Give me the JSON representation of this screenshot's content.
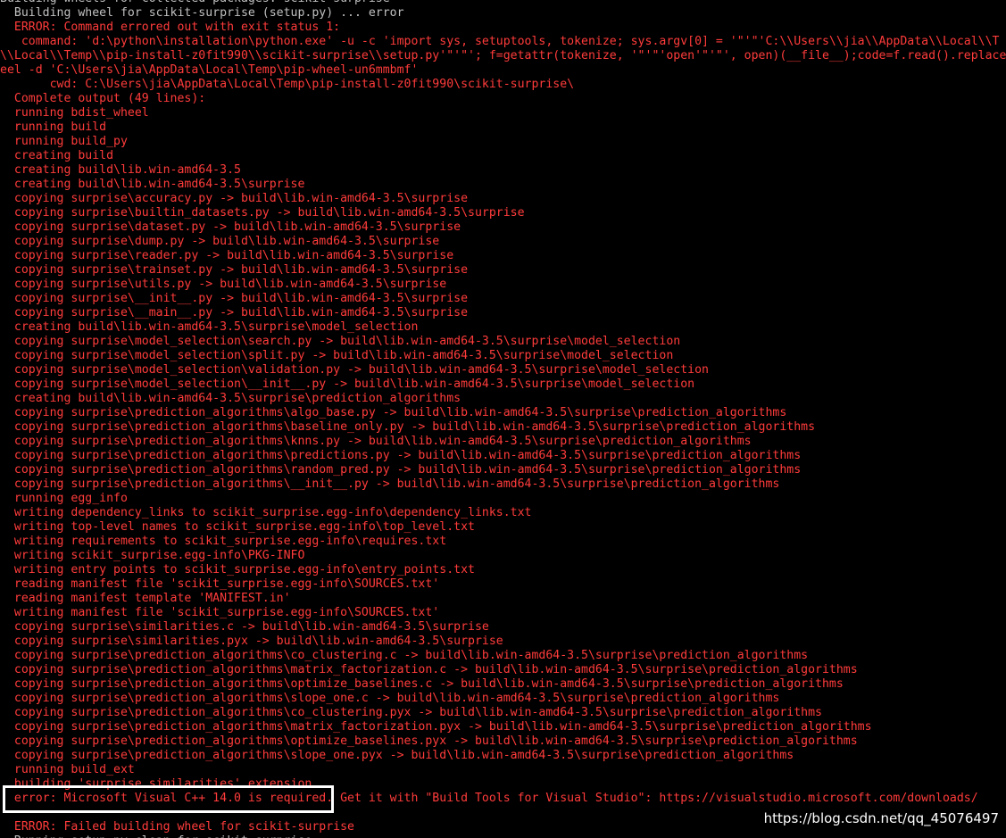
{
  "terminal": {
    "lines": [
      {
        "text": "Building wheels for collected packages: scikit-surprise",
        "color": "gray"
      },
      {
        "text": "  Building wheel for scikit-surprise (setup.py) ... error",
        "color": "gray"
      },
      {
        "text": "  ERROR: Command errored out with exit status 1:",
        "color": "red"
      },
      {
        "text": "   command: 'd:\\python\\installation\\python.exe' -u -c 'import sys, setuptools, tokenize; sys.argv[0] = '\"'\"'C:\\\\Users\\\\jia\\\\AppData\\\\Local\\\\T",
        "color": "red"
      },
      {
        "text": "\\\\Local\\\\Temp\\\\pip-install-z0fit990\\\\scikit-surprise\\\\setup.py'\"'\"'; f=getattr(tokenize, '\"'\"'open'\"'\"', open)(__file__);code=f.read().replace",
        "color": "red"
      },
      {
        "text": "eel -d 'C:\\Users\\jia\\AppData\\Local\\Temp\\pip-wheel-un6mmbmf'",
        "color": "red"
      },
      {
        "text": "       cwd: C:\\Users\\jia\\AppData\\Local\\Temp\\pip-install-z0fit990\\scikit-surprise\\",
        "color": "red"
      },
      {
        "text": "  Complete output (49 lines):",
        "color": "red"
      },
      {
        "text": "  running bdist_wheel",
        "color": "red"
      },
      {
        "text": "  running build",
        "color": "red"
      },
      {
        "text": "  running build_py",
        "color": "red"
      },
      {
        "text": "  creating build",
        "color": "red"
      },
      {
        "text": "  creating build\\lib.win-amd64-3.5",
        "color": "red"
      },
      {
        "text": "  creating build\\lib.win-amd64-3.5\\surprise",
        "color": "red"
      },
      {
        "text": "  copying surprise\\accuracy.py -> build\\lib.win-amd64-3.5\\surprise",
        "color": "red"
      },
      {
        "text": "  copying surprise\\builtin_datasets.py -> build\\lib.win-amd64-3.5\\surprise",
        "color": "red"
      },
      {
        "text": "  copying surprise\\dataset.py -> build\\lib.win-amd64-3.5\\surprise",
        "color": "red"
      },
      {
        "text": "  copying surprise\\dump.py -> build\\lib.win-amd64-3.5\\surprise",
        "color": "red"
      },
      {
        "text": "  copying surprise\\reader.py -> build\\lib.win-amd64-3.5\\surprise",
        "color": "red"
      },
      {
        "text": "  copying surprise\\trainset.py -> build\\lib.win-amd64-3.5\\surprise",
        "color": "red"
      },
      {
        "text": "  copying surprise\\utils.py -> build\\lib.win-amd64-3.5\\surprise",
        "color": "red"
      },
      {
        "text": "  copying surprise\\__init__.py -> build\\lib.win-amd64-3.5\\surprise",
        "color": "red"
      },
      {
        "text": "  copying surprise\\__main__.py -> build\\lib.win-amd64-3.5\\surprise",
        "color": "red"
      },
      {
        "text": "  creating build\\lib.win-amd64-3.5\\surprise\\model_selection",
        "color": "red"
      },
      {
        "text": "  copying surprise\\model_selection\\search.py -> build\\lib.win-amd64-3.5\\surprise\\model_selection",
        "color": "red"
      },
      {
        "text": "  copying surprise\\model_selection\\split.py -> build\\lib.win-amd64-3.5\\surprise\\model_selection",
        "color": "red"
      },
      {
        "text": "  copying surprise\\model_selection\\validation.py -> build\\lib.win-amd64-3.5\\surprise\\model_selection",
        "color": "red"
      },
      {
        "text": "  copying surprise\\model_selection\\__init__.py -> build\\lib.win-amd64-3.5\\surprise\\model_selection",
        "color": "red"
      },
      {
        "text": "  creating build\\lib.win-amd64-3.5\\surprise\\prediction_algorithms",
        "color": "red"
      },
      {
        "text": "  copying surprise\\prediction_algorithms\\algo_base.py -> build\\lib.win-amd64-3.5\\surprise\\prediction_algorithms",
        "color": "red"
      },
      {
        "text": "  copying surprise\\prediction_algorithms\\baseline_only.py -> build\\lib.win-amd64-3.5\\surprise\\prediction_algorithms",
        "color": "red"
      },
      {
        "text": "  copying surprise\\prediction_algorithms\\knns.py -> build\\lib.win-amd64-3.5\\surprise\\prediction_algorithms",
        "color": "red"
      },
      {
        "text": "  copying surprise\\prediction_algorithms\\predictions.py -> build\\lib.win-amd64-3.5\\surprise\\prediction_algorithms",
        "color": "red"
      },
      {
        "text": "  copying surprise\\prediction_algorithms\\random_pred.py -> build\\lib.win-amd64-3.5\\surprise\\prediction_algorithms",
        "color": "red"
      },
      {
        "text": "  copying surprise\\prediction_algorithms\\__init__.py -> build\\lib.win-amd64-3.5\\surprise\\prediction_algorithms",
        "color": "red"
      },
      {
        "text": "  running egg_info",
        "color": "red"
      },
      {
        "text": "  writing dependency_links to scikit_surprise.egg-info\\dependency_links.txt",
        "color": "red"
      },
      {
        "text": "  writing top-level names to scikit_surprise.egg-info\\top_level.txt",
        "color": "red"
      },
      {
        "text": "  writing requirements to scikit_surprise.egg-info\\requires.txt",
        "color": "red"
      },
      {
        "text": "  writing scikit_surprise.egg-info\\PKG-INFO",
        "color": "red"
      },
      {
        "text": "  writing entry points to scikit_surprise.egg-info\\entry_points.txt",
        "color": "red"
      },
      {
        "text": "  reading manifest file 'scikit_surprise.egg-info\\SOURCES.txt'",
        "color": "red"
      },
      {
        "text": "  reading manifest template 'MANIFEST.in'",
        "color": "red"
      },
      {
        "text": "  writing manifest file 'scikit_surprise.egg-info\\SOURCES.txt'",
        "color": "red"
      },
      {
        "text": "  copying surprise\\similarities.c -> build\\lib.win-amd64-3.5\\surprise",
        "color": "red"
      },
      {
        "text": "  copying surprise\\similarities.pyx -> build\\lib.win-amd64-3.5\\surprise",
        "color": "red"
      },
      {
        "text": "  copying surprise\\prediction_algorithms\\co_clustering.c -> build\\lib.win-amd64-3.5\\surprise\\prediction_algorithms",
        "color": "red"
      },
      {
        "text": "  copying surprise\\prediction_algorithms\\matrix_factorization.c -> build\\lib.win-amd64-3.5\\surprise\\prediction_algorithms",
        "color": "red"
      },
      {
        "text": "  copying surprise\\prediction_algorithms\\optimize_baselines.c -> build\\lib.win-amd64-3.5\\surprise\\prediction_algorithms",
        "color": "red"
      },
      {
        "text": "  copying surprise\\prediction_algorithms\\slope_one.c -> build\\lib.win-amd64-3.5\\surprise\\prediction_algorithms",
        "color": "red"
      },
      {
        "text": "  copying surprise\\prediction_algorithms\\co_clustering.pyx -> build\\lib.win-amd64-3.5\\surprise\\prediction_algorithms",
        "color": "red"
      },
      {
        "text": "  copying surprise\\prediction_algorithms\\matrix_factorization.pyx -> build\\lib.win-amd64-3.5\\surprise\\prediction_algorithms",
        "color": "red"
      },
      {
        "text": "  copying surprise\\prediction_algorithms\\optimize_baselines.pyx -> build\\lib.win-amd64-3.5\\surprise\\prediction_algorithms",
        "color": "red"
      },
      {
        "text": "  copying surprise\\prediction_algorithms\\slope_one.pyx -> build\\lib.win-amd64-3.5\\surprise\\prediction_algorithms",
        "color": "red"
      },
      {
        "text": "  running build_ext",
        "color": "red"
      },
      {
        "text": "  building 'surprise.similarities' extension",
        "color": "red"
      },
      {
        "text": "  error: Microsoft Visual C++ 14.0 is required. Get it with \"Build Tools for Visual Studio\": https://visualstudio.microsoft.com/downloads/",
        "color": "red"
      },
      {
        "text": "  ----------------------------------------",
        "color": "red"
      },
      {
        "text": "  ERROR: Failed building wheel for scikit-surprise",
        "color": "red"
      },
      {
        "text": "  Running setup.py clean for scikit-surprise",
        "color": "gray"
      }
    ]
  },
  "watermark": "https://blog.csdn.net/qq_45076497",
  "colors": {
    "background": "#000000",
    "error_text": "#ff3b3b",
    "normal_text": "#c0c0c0",
    "highlight_border": "#ffffff"
  }
}
